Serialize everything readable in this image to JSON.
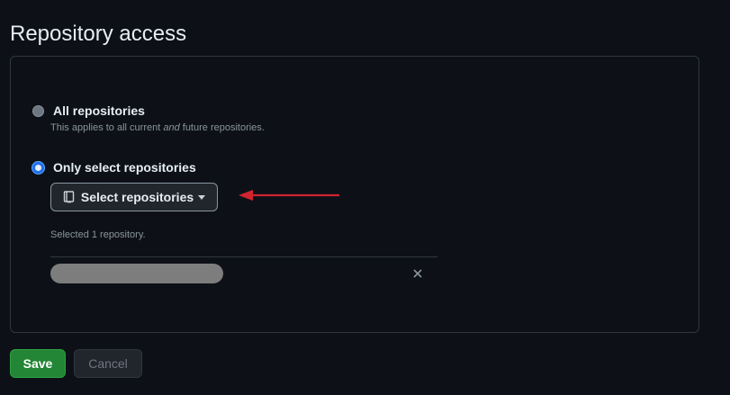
{
  "page_title": "Repository access",
  "options": [
    {
      "label": "All repositories",
      "description_before": "This applies to all current ",
      "description_em": "and",
      "description_after": " future repositories.",
      "selected": false
    },
    {
      "label": "Only select repositories",
      "selected": true
    }
  ],
  "select_button": {
    "label": "Select repositories",
    "icon": "repo-icon"
  },
  "selected_count_text": "Selected 1 repository.",
  "selected_repos": [
    {
      "name": "",
      "redacted": true
    }
  ],
  "actions": {
    "save_label": "Save",
    "cancel_label": "Cancel"
  },
  "colors": {
    "background": "#0d1117",
    "border": "#30363d",
    "save_green": "#238636",
    "annotation_arrow": "#d1242f"
  }
}
